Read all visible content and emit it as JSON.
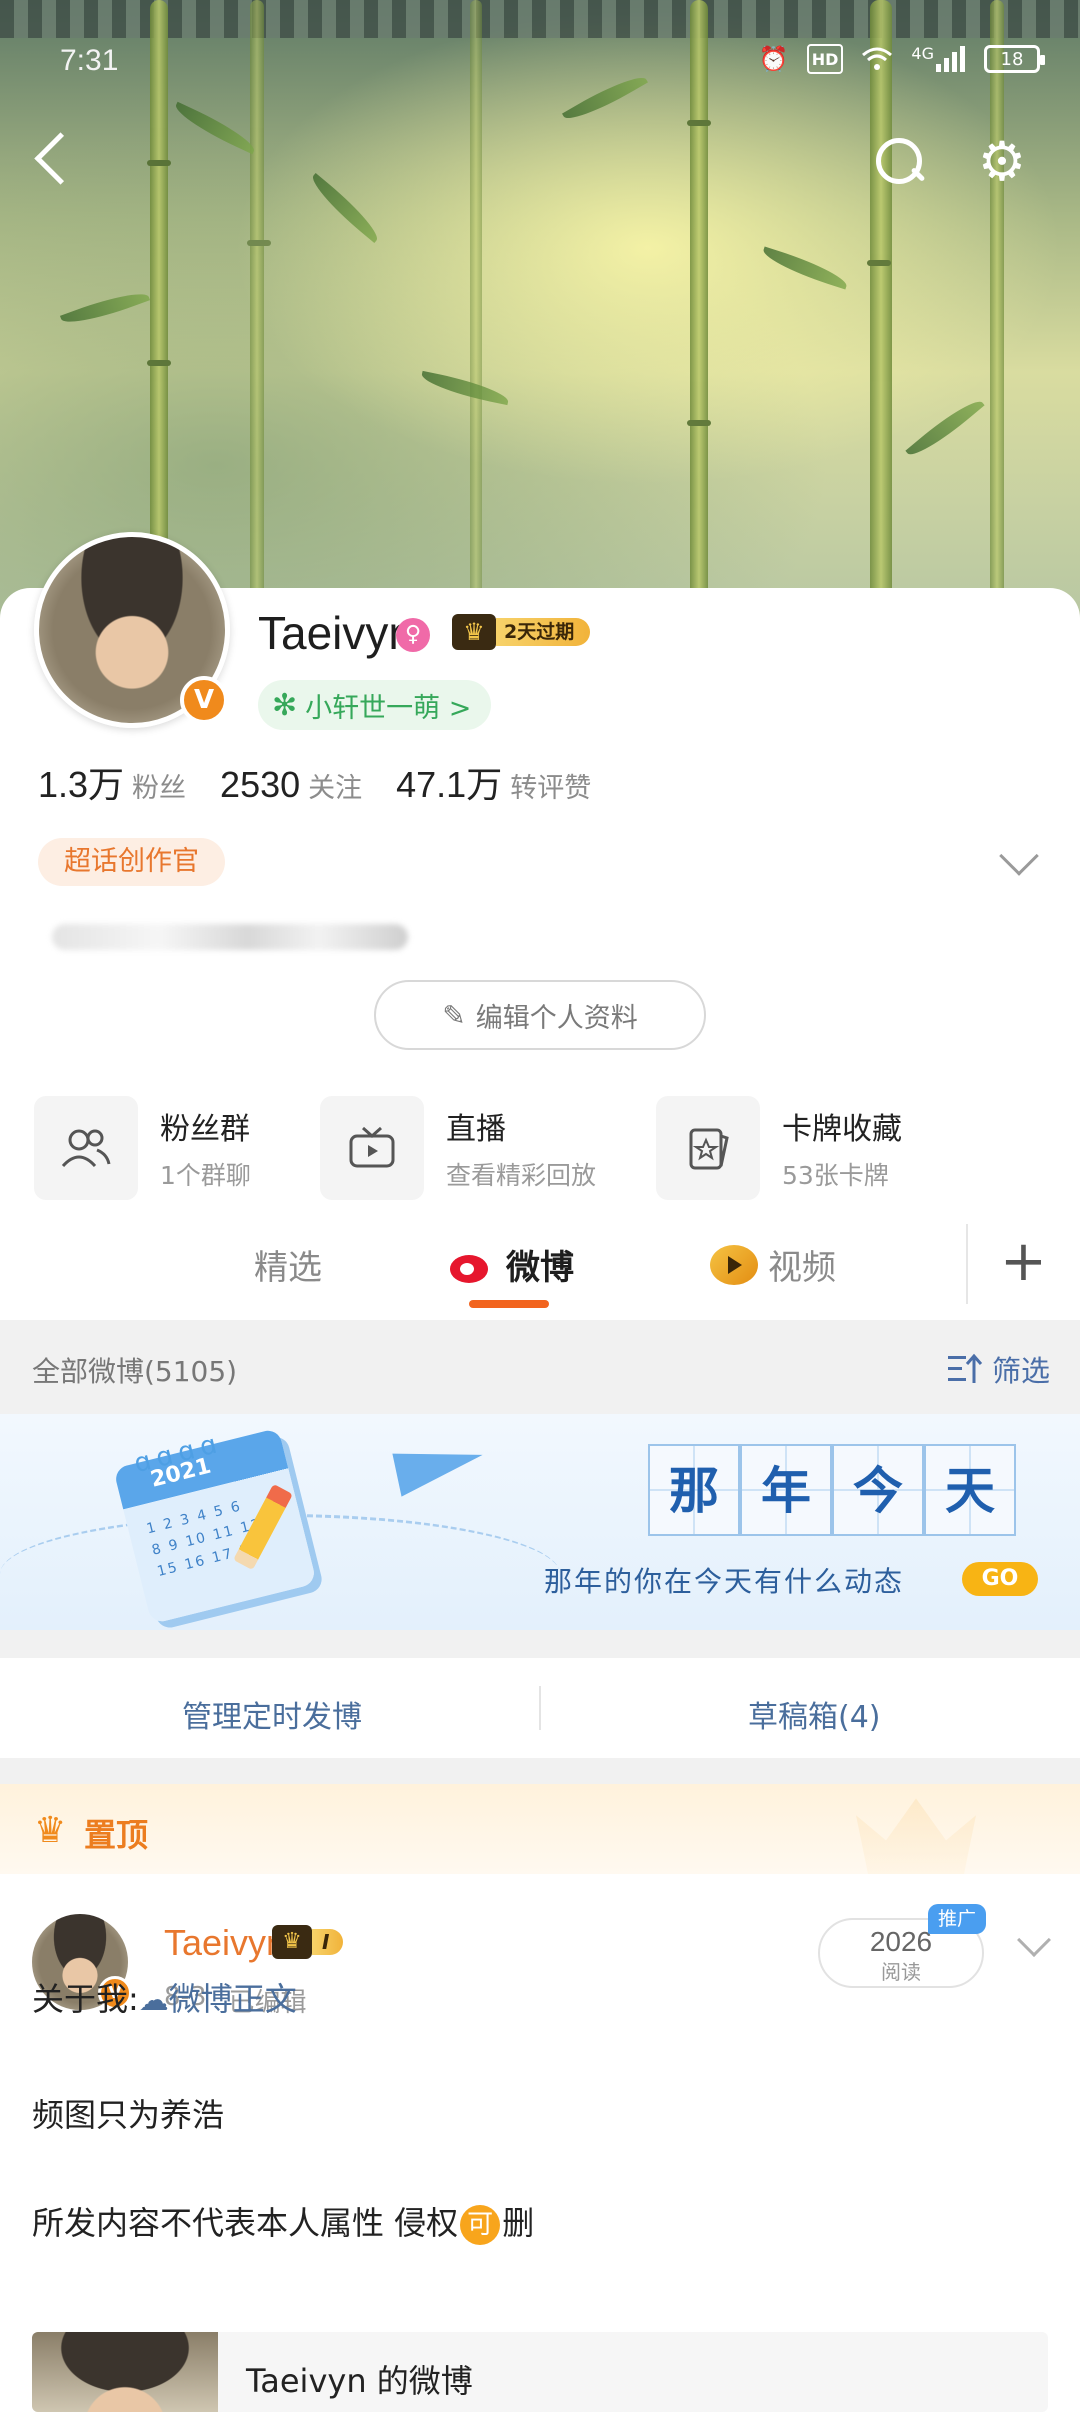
{
  "status_bar": {
    "time": "7:31",
    "hd": "HD",
    "network": "4G",
    "battery": "18",
    "icons": [
      "alarm-icon",
      "hd-icon",
      "wifi-icon",
      "signal-icon",
      "battery-icon"
    ]
  },
  "nav": {
    "icons": [
      "back-icon",
      "search-icon",
      "settings-icon"
    ]
  },
  "profile": {
    "name": "Taeivyn",
    "verified_badge": "V",
    "vip_badge": "2天过期",
    "group_pill": "小轩世一萌 >",
    "stats": [
      {
        "value": "1.3万",
        "label": "粉丝"
      },
      {
        "value": "2530",
        "label": "关注"
      },
      {
        "value": "47.1万",
        "label": "转评赞"
      }
    ],
    "tag": "超话创作官",
    "edit_button": "编辑个人资料"
  },
  "features": [
    {
      "title": "粉丝群",
      "sub": "1个群聊",
      "icon": "fans-group-icon"
    },
    {
      "title": "直播",
      "sub": "查看精彩回放",
      "icon": "live-tv-icon"
    },
    {
      "title": "卡牌收藏",
      "sub": "53张卡牌",
      "icon": "card-collection-icon"
    }
  ],
  "tabs": [
    {
      "label": "精选",
      "active": false
    },
    {
      "label": "微博",
      "active": true
    },
    {
      "label": "视频",
      "active": false
    }
  ],
  "section": {
    "all_posts": "全部微博(5105)",
    "filter": "筛选"
  },
  "memory": {
    "year": "2021",
    "title_chars": [
      "那",
      "年",
      "今",
      "天"
    ],
    "subtitle": "那年的你在今天有什么动态",
    "go": "GO"
  },
  "actions": {
    "scheduled": "管理定时发博",
    "drafts": "草稿箱(4)"
  },
  "pinned": {
    "label": "置顶"
  },
  "post": {
    "author": "Taeivyn",
    "level": "I",
    "date": "8-3",
    "edited": "已编辑",
    "reads": "2026",
    "reads_label": "阅读",
    "promo": "推广",
    "line1_prefix": "关于我:",
    "line1_link": "微博正文",
    "line2": "频图只为养浩",
    "line3_prefix": "所发内容不代表本人属性 侵权",
    "line3_badge": "可",
    "line3_suffix": "删",
    "card_title": "Taeivyn 的微博"
  },
  "colors": {
    "accent_orange": "#f2641e",
    "link_blue": "#4a6e9c",
    "green": "#36a85a",
    "pinned_orange": "#ec7d1f"
  }
}
